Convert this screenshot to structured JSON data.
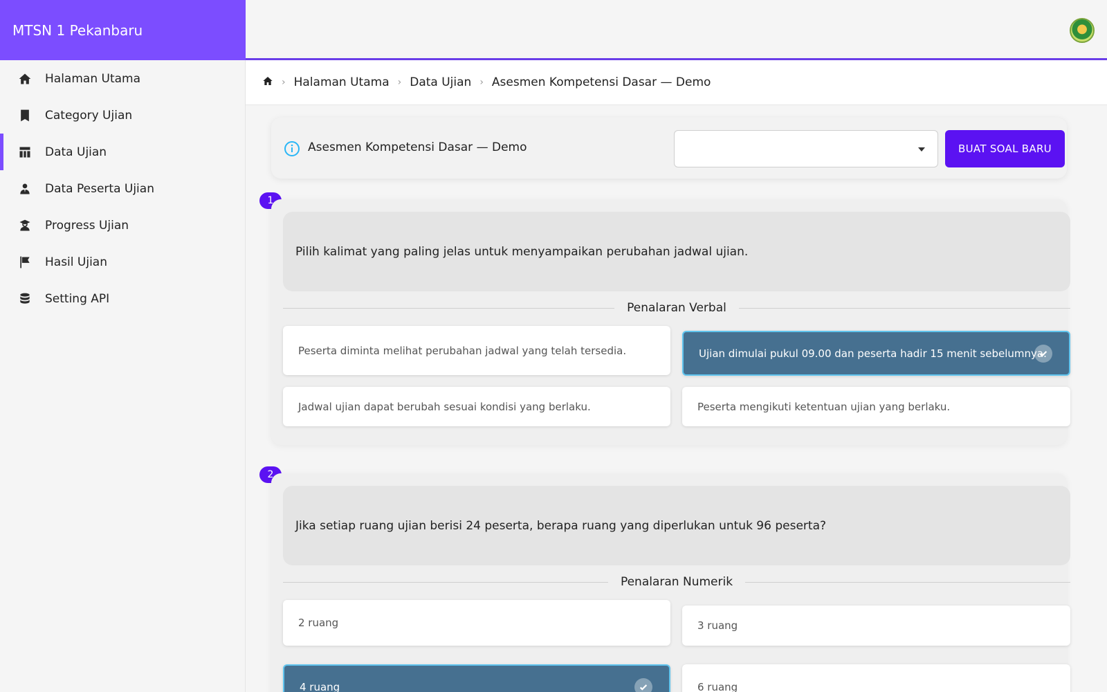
{
  "app": {
    "title": "MTSN 1 Pekanbaru"
  },
  "sidebar": {
    "items": [
      {
        "label": "Halaman Utama",
        "icon": "home-icon"
      },
      {
        "label": "Category Ujian",
        "icon": "bookmark-icon"
      },
      {
        "label": "Data Ujian",
        "icon": "table-icon",
        "active": true
      },
      {
        "label": "Data Peserta Ujian",
        "icon": "user-tie-icon"
      },
      {
        "label": "Progress Ujian",
        "icon": "user-graduate-icon"
      },
      {
        "label": "Hasil Ujian",
        "icon": "flag-icon"
      },
      {
        "label": "Setting API",
        "icon": "database-icon"
      }
    ]
  },
  "breadcrumb": {
    "items": [
      "Halaman Utama",
      "Data Ujian",
      "Asesmen Kompetensi Dasar — Demo"
    ]
  },
  "toolbar": {
    "title": "Asesmen Kompetensi Dasar — Demo",
    "select_value": "",
    "new_button": "BUAT SOAL BARU"
  },
  "colors": {
    "accent": "#7c4dff",
    "button": "#5b12f2",
    "correct": "#467090",
    "correct_border": "#5fc4ee"
  },
  "questions": [
    {
      "number": "1",
      "text": "Pilih kalimat yang paling jelas untuk menyampaikan perubahan jadwal ujian.",
      "category": "Penalaran Verbal",
      "options": [
        {
          "text": "Peserta diminta melihat perubahan jadwal yang telah tersedia.",
          "correct": false
        },
        {
          "text": "Ujian dimulai pukul 09.00 dan peserta hadir 15 menit sebelumnya.",
          "correct": true
        },
        {
          "text": "Jadwal ujian dapat berubah sesuai kondisi yang berlaku.",
          "correct": false
        },
        {
          "text": "Peserta mengikuti ketentuan ujian yang berlaku.",
          "correct": false
        }
      ]
    },
    {
      "number": "2",
      "text": "Jika setiap ruang ujian berisi 24 peserta, berapa ruang yang diperlukan untuk 96 peserta?",
      "category": "Penalaran Numerik",
      "options": [
        {
          "text": "2 ruang",
          "correct": false
        },
        {
          "text": "3 ruang",
          "correct": false
        },
        {
          "text": "4 ruang",
          "correct": true
        },
        {
          "text": "6 ruang",
          "correct": false
        }
      ]
    }
  ]
}
